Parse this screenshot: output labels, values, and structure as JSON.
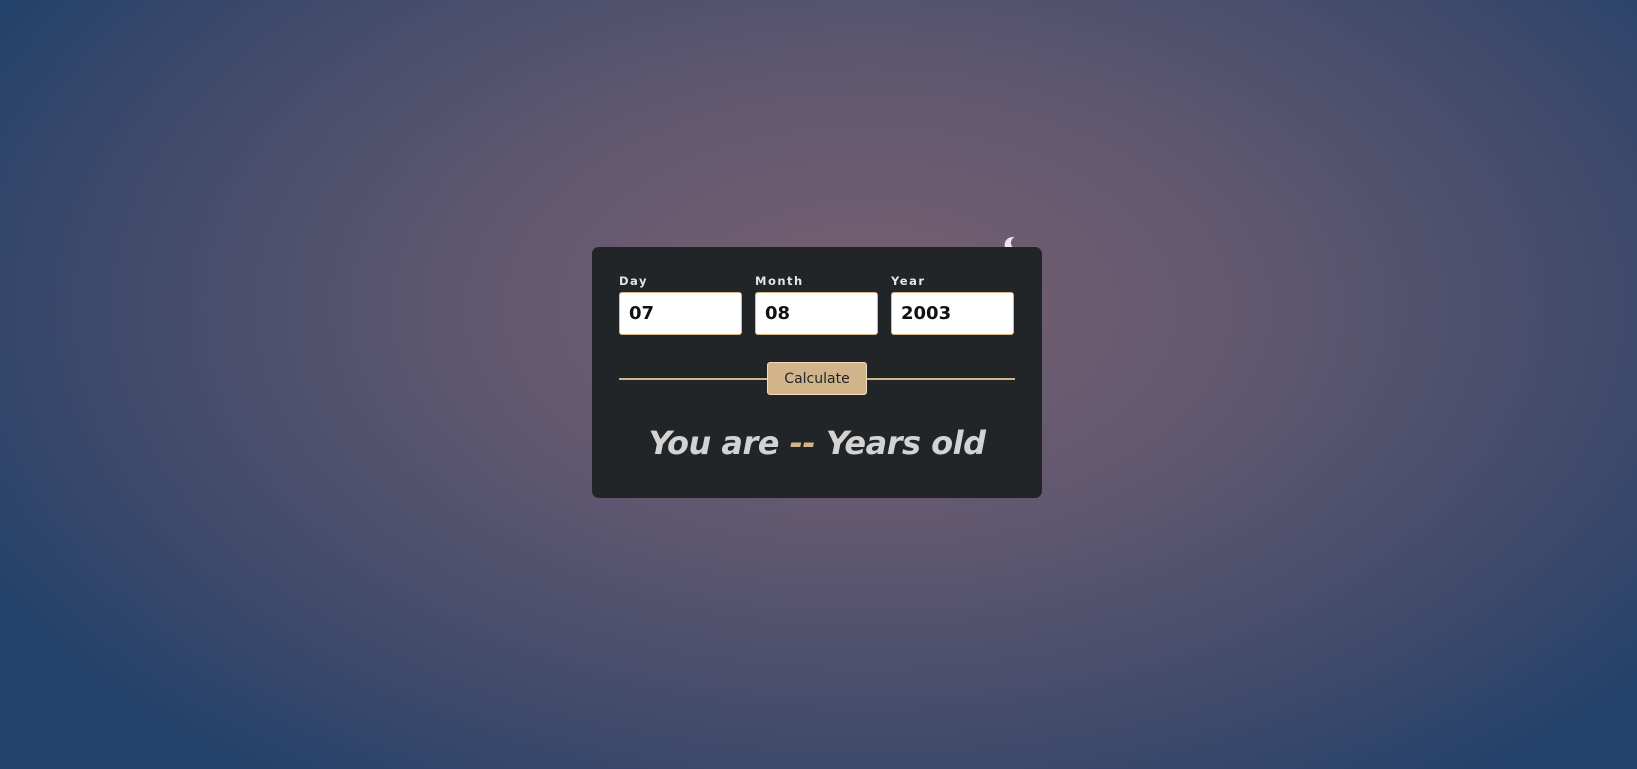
{
  "theme_toggle": {
    "icon": "moon-icon"
  },
  "form": {
    "day": {
      "label": "Day",
      "value": "07"
    },
    "month": {
      "label": "Month",
      "value": "08"
    },
    "year": {
      "label": "Year",
      "value": "2003"
    }
  },
  "calculate_button": {
    "label": "Calculate"
  },
  "result": {
    "prefix": "You are",
    "age": "--",
    "suffix": "Years old"
  },
  "colors": {
    "card_background": "#212528",
    "accent": "#d2b48a",
    "result_text": "#d3d3d3"
  }
}
